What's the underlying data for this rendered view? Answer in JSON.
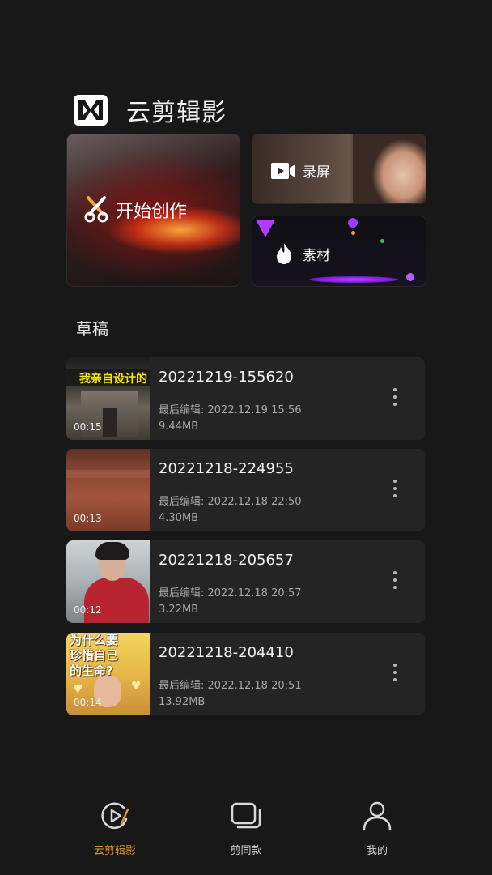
{
  "app": {
    "title": "云剪辑影"
  },
  "entries": {
    "create_label": "开始创作",
    "record_label": "录屏",
    "material_label": "素材"
  },
  "drafts": {
    "title": "草稿",
    "items": [
      {
        "name": "20221219-155620",
        "edited": "最后编辑: 2022.12.19 15:56",
        "size": "9.44MB",
        "duration": "00:15",
        "thumb_text": "我亲自设计的"
      },
      {
        "name": "20221218-224955",
        "edited": "最后编辑: 2022.12.18 22:50",
        "size": "4.30MB",
        "duration": "00:13"
      },
      {
        "name": "20221218-205657",
        "edited": "最后编辑: 2022.12.18 20:57",
        "size": "3.22MB",
        "duration": "00:12"
      },
      {
        "name": "20221218-204410",
        "edited": "最后编辑: 2022.12.18 20:51",
        "size": "13.92MB",
        "duration": "00:14",
        "thumb_text": "为什么要\n珍惜自己\n的生命?"
      }
    ]
  },
  "tabbar": {
    "active_color": "#d89a36",
    "tabs": [
      {
        "label": "云剪辑影",
        "icon": "play-edit-icon",
        "active": true
      },
      {
        "label": "剪同款",
        "icon": "stacked-cards-icon",
        "active": false
      },
      {
        "label": "我的",
        "icon": "person-icon",
        "active": false
      }
    ]
  }
}
